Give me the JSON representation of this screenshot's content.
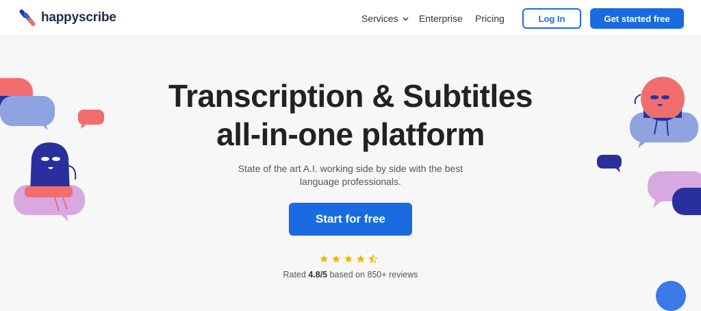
{
  "brand": {
    "name": "happyscribe"
  },
  "nav": {
    "items": [
      {
        "label": "Services",
        "has_dropdown": true
      },
      {
        "label": "Enterprise"
      },
      {
        "label": "Pricing"
      }
    ],
    "login_label": "Log In",
    "get_started_label": "Get started free"
  },
  "hero": {
    "title_line1": "Transcription & Subtitles",
    "title_line2": "all-in-one platform",
    "subtitle_line1": "State of the art A.I. working side by side with the best",
    "subtitle_line2": "language professionals.",
    "cta_label": "Start for free"
  },
  "rating": {
    "stars": 4.5,
    "prefix": "Rated ",
    "score": "4.8/5",
    "suffix": " based on 850+ reviews"
  },
  "colors": {
    "primary": "#1a6be0",
    "coral": "#f26d6d",
    "navy": "#2a2f9e",
    "periwinkle": "#8ea3e0",
    "lavender": "#d8a8e0",
    "star": "#f5b500"
  }
}
